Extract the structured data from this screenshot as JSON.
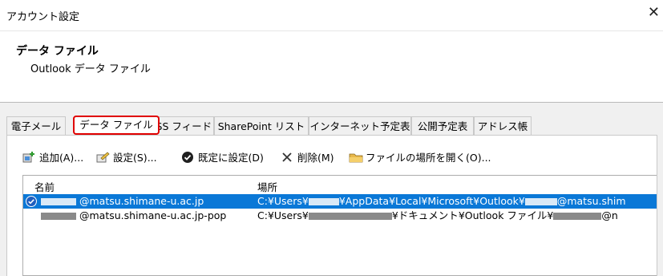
{
  "window": {
    "title": "アカウント設定",
    "close_glyph": "✕"
  },
  "header": {
    "title": "データ ファイル",
    "subtitle": "Outlook データ ファイル"
  },
  "tabs": [
    {
      "label": "電子メール",
      "active": false
    },
    {
      "label": "データ ファイル",
      "active": true
    },
    {
      "label": "RSS フィード",
      "active": false
    },
    {
      "label": "SharePoint リスト",
      "active": false
    },
    {
      "label": "インターネット予定表",
      "active": false
    },
    {
      "label": "公開予定表",
      "active": false
    },
    {
      "label": "アドレス帳",
      "active": false
    }
  ],
  "toolbar": {
    "add_label": "追加(A)...",
    "settings_label": "設定(S)...",
    "default_label": "既定に設定(D)",
    "delete_label": "削除(M)",
    "open_location_label": "ファイルの場所を開く(O)..."
  },
  "list": {
    "columns": [
      "名前",
      "場所"
    ],
    "rows": [
      {
        "name": "@matsu.shimane-u.ac.jp",
        "location_prefix": "C:¥Users¥",
        "location_mid": "¥AppData¥Local¥Microsoft¥Outlook¥",
        "location_suffix": "@matsu.shim",
        "selected": true,
        "is_default": true
      },
      {
        "name": "@matsu.shimane-u.ac.jp-pop",
        "location_prefix": "C:¥Users¥",
        "location_mid": "¥ドキュメント¥Outlook ファイル¥",
        "location_suffix": "@n",
        "selected": false,
        "is_default": false
      }
    ]
  },
  "colors": {
    "selection": "#0a78d7",
    "tab_highlight": "#e00000",
    "default_check": "#1f5fbf"
  }
}
